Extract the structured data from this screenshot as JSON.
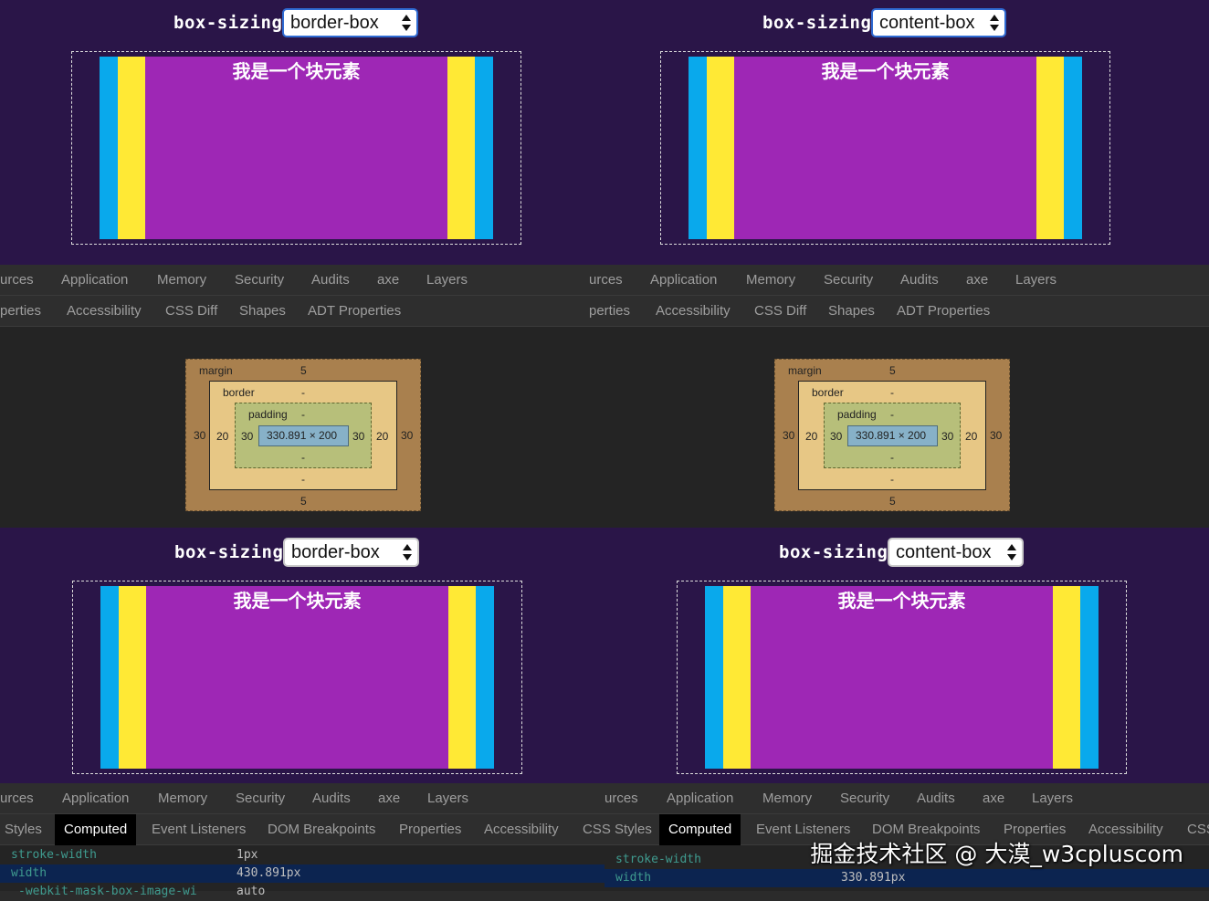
{
  "panels": [
    {
      "label": "box-sizing:",
      "select_value": "border-box",
      "box_text": "我是一个块元素",
      "tabs_row1": [
        "urces",
        "Application",
        "Memory",
        "Security",
        "Audits",
        "axe",
        "Layers"
      ],
      "tabs_row2": [
        "perties",
        "Accessibility",
        "CSS Diff",
        "Shapes",
        "ADT Properties"
      ],
      "box_model": {
        "margin_label": "margin",
        "margin_top": "5",
        "margin_bottom": "5",
        "margin_left": "30",
        "margin_right": "30",
        "border_label": "border",
        "border_top": "-",
        "border_bottom": "-",
        "border_left": "20",
        "border_right": "20",
        "padding_label": "padding",
        "padding_top": "-",
        "padding_bottom": "-",
        "padding_left": "30",
        "padding_right": "30",
        "content": "330.891 × 200"
      }
    },
    {
      "label": "box-sizing:",
      "select_value": "content-box",
      "box_text": "我是一个块元素",
      "tabs_row1": [
        "urces",
        "Application",
        "Memory",
        "Security",
        "Audits",
        "axe",
        "Layers"
      ],
      "tabs_row2": [
        "perties",
        "Accessibility",
        "CSS Diff",
        "Shapes",
        "ADT Properties"
      ],
      "box_model": {
        "margin_label": "margin",
        "margin_top": "5",
        "margin_bottom": "5",
        "margin_left": "30",
        "margin_right": "30",
        "border_label": "border",
        "border_top": "-",
        "border_bottom": "-",
        "border_left": "20",
        "border_right": "20",
        "padding_label": "padding",
        "padding_top": "-",
        "padding_bottom": "-",
        "padding_left": "30",
        "padding_right": "30",
        "content": "330.891 × 200"
      }
    },
    {
      "label": "box-sizing:",
      "select_value": "border-box",
      "box_text": "我是一个块元素",
      "tabs_row1": [
        "urces",
        "Application",
        "Memory",
        "Security",
        "Audits",
        "axe",
        "Layers"
      ],
      "tabs_row2": [
        "Styles",
        "Computed",
        "Event Listeners",
        "DOM Breakpoints",
        "Properties",
        "Accessibility",
        "CSS Styles"
      ],
      "selected_tab": "Computed",
      "computed": [
        {
          "name": "stroke-width",
          "value": "1px"
        },
        {
          "name": "width",
          "value": "430.891px"
        },
        {
          "name": "-webkit-mask-box-image-wi",
          "value": "auto"
        }
      ]
    },
    {
      "label": "box-sizing:",
      "select_value": "content-box",
      "box_text": "我是一个块元素",
      "tabs_row1": [
        "urces",
        "Application",
        "Memory",
        "Security",
        "Audits",
        "axe",
        "Layers"
      ],
      "tabs_row2": [
        "CSS Styles",
        "Computed",
        "Event Listeners",
        "DOM Breakpoints",
        "Properties",
        "Accessibility",
        "CSS"
      ],
      "selected_tab": "Computed",
      "computed": [
        {
          "name": "stroke-width",
          "value": ""
        },
        {
          "name": "width",
          "value": "330.891px"
        }
      ]
    }
  ],
  "watermark": "掘金技术社区 @ 大漠_w3cpluscom",
  "colors": {
    "demo_bg": "#2a1548",
    "blue_border": "#09a9ec",
    "yellow_padding": "#ffe935",
    "purple_content": "#9e27b5",
    "devtools_bg": "#2b2b2b",
    "margin": "#a9804e",
    "border": "#e7c785",
    "padding": "#b7bf7a",
    "content": "#87b1c8"
  }
}
